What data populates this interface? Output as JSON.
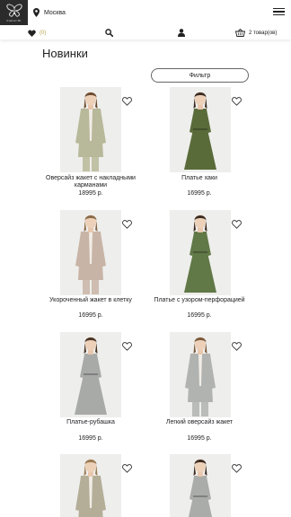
{
  "header": {
    "logo_text": "NARACHI",
    "city": "Москва"
  },
  "toolbar": {
    "favorites_count": "(0)",
    "cart_label": "2 товар(ов)"
  },
  "page": {
    "title": "Новинки",
    "filter_label": "Фильтр"
  },
  "products": [
    {
      "name_line1": "Оверсайз жакет с накладными",
      "name_line2": "карманами",
      "price": "18995 р."
    },
    {
      "name_line1": "Платье хаки",
      "name_line2": "",
      "price": "16995 р."
    },
    {
      "name_line1": "Укороченный жакет в клетку",
      "name_line2": "",
      "price": "16995 р."
    },
    {
      "name_line1": "Платье с узором-перфорацией",
      "name_line2": "",
      "price": "16995 р."
    },
    {
      "name_line1": "Платье-рубашка",
      "name_line2": "",
      "price": "16995 р."
    },
    {
      "name_line1": "Легкий оверсайз жакет",
      "name_line2": "",
      "price": "16995 р."
    },
    {
      "name_line1": "",
      "name_line2": "",
      "price": ""
    },
    {
      "name_line1": "",
      "name_line2": "",
      "price": ""
    }
  ],
  "colors": {
    "accent": "#b7a24a",
    "logo_bg": "#2b2b2b",
    "garment_1": "#b8b89a",
    "garment_2": "#5a6b3a",
    "garment_3": "#c8b4a6",
    "garment_4": "#617847",
    "garment_5": "#a8aaa8",
    "garment_6": "#b0b3b0",
    "garment_7": "#b4ae98",
    "garment_8": "#a9aca9"
  },
  "icons": [
    "location-pin-icon",
    "menu-icon",
    "heart-icon",
    "search-icon",
    "user-icon",
    "basket-icon",
    "favorite-heart-icon"
  ]
}
